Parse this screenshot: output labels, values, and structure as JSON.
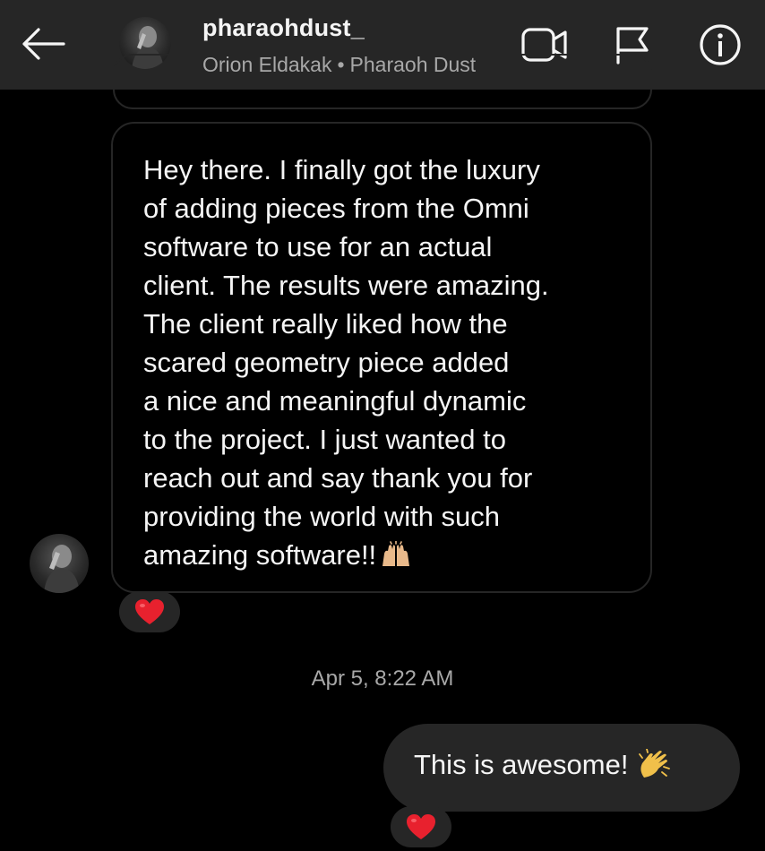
{
  "header": {
    "username": "pharaohdust_",
    "full_name": "Orion Eldakak",
    "separator": "•",
    "secondary_name": "Pharaoh Dust",
    "icons": {
      "back": "arrow-left-icon",
      "video": "video-camera-icon",
      "flag": "flag-icon",
      "info": "info-icon"
    }
  },
  "messages": {
    "incoming_text": "Hey there. I finally got the luxury\nof adding pieces from the Omni\nsoftware to use for an actual\nclient. The results were amazing.\nThe client really liked how the\nscared geometry piece added\na nice and meaningful dynamic\nto the project. I just wanted to\nreach out and say thank you for\nproviding the world with such\namazing software!!",
    "incoming_emoji": "raising-hands-emoji",
    "timestamp": "Apr 5, 8:22 AM",
    "outgoing_text": "This is awesome!",
    "outgoing_emoji": "clapping-hands-emoji",
    "reaction_icon": "red-heart-icon"
  },
  "colors": {
    "background": "#000000",
    "header_bg": "#262626",
    "bubble_out_bg": "#262626",
    "bubble_border": "#262626",
    "secondary_text": "#a8a8a8",
    "heart": "#e8212e",
    "emoji_skin": "#e8b98a"
  }
}
